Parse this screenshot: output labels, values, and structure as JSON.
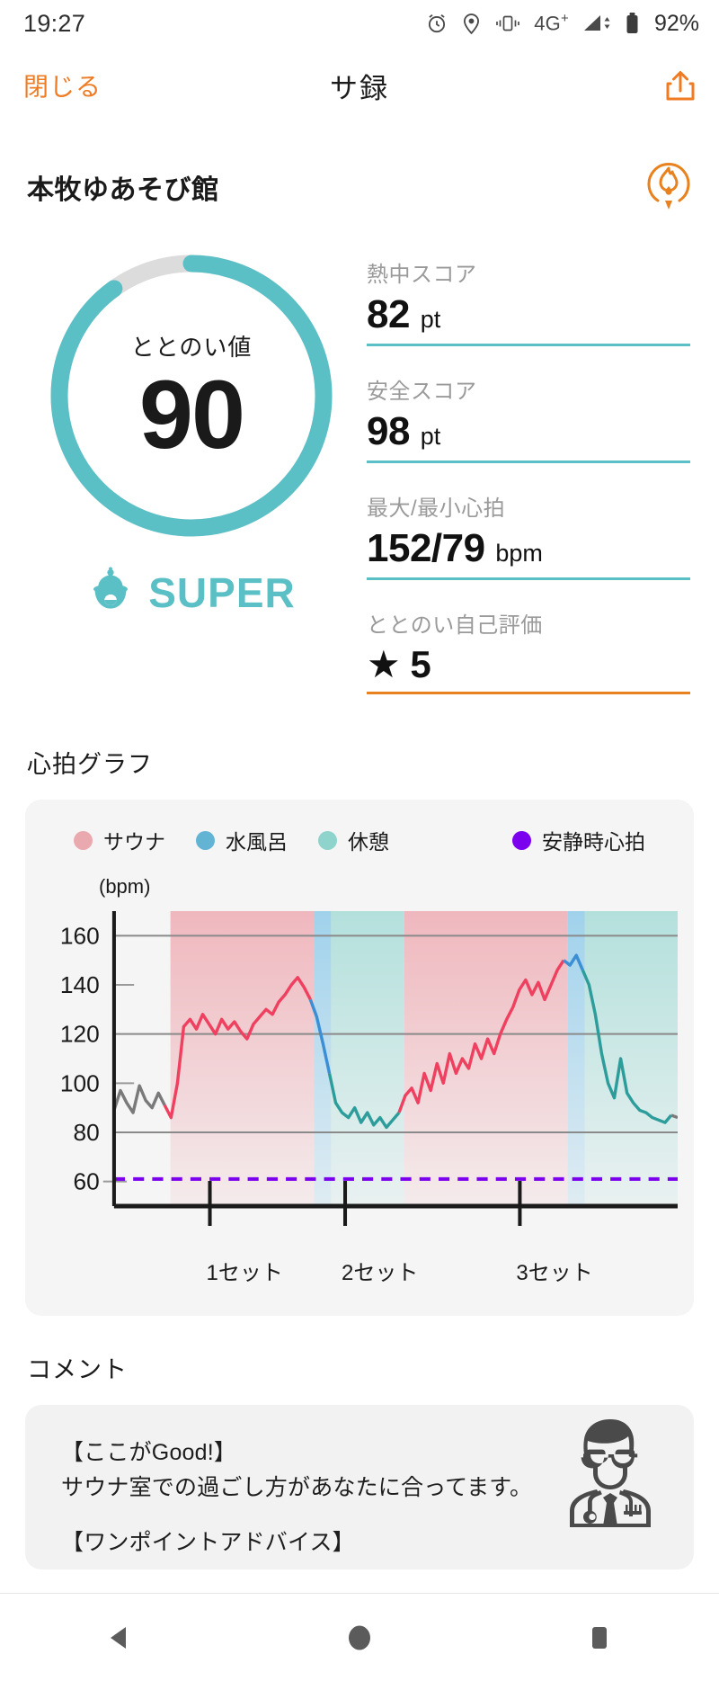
{
  "status_bar": {
    "time": "19:27",
    "network": "4G",
    "network_sup": "+",
    "battery": "92%",
    "icons": [
      "alarm-icon",
      "location-icon",
      "vibrate-icon",
      "signal-icon",
      "battery-icon"
    ]
  },
  "nav": {
    "close_label": "閉じる",
    "title": "サ録",
    "share_icon": "share-icon",
    "close_color": "#ef7b22"
  },
  "venue": {
    "name": "本牧ゆあそび館",
    "badge_icon": "flame-circle-icon",
    "badge_color": "#e8821e"
  },
  "gauge": {
    "label": "ととのい値",
    "value": "90",
    "percent": 90,
    "track_color": "#dcdcdc",
    "fill_color": "#5bc0c6",
    "rank_label": "SUPER",
    "rank_icon": "sauna-hat-character-icon",
    "rank_color": "#5bc0c6"
  },
  "stats": [
    {
      "label": "熱中スコア",
      "value": "82",
      "unit": "pt",
      "rule_color": "#5bc0c6"
    },
    {
      "label": "安全スコア",
      "value": "98",
      "unit": "pt",
      "rule_color": "#5bc0c6"
    },
    {
      "label": "最大/最小心拍",
      "value": "152/79",
      "unit": "bpm",
      "rule_color": "#5bc0c6"
    },
    {
      "label": "ととのい自己評価",
      "value": "★ 5",
      "unit": "",
      "rule_color": "#e8821e"
    }
  ],
  "chart_section": {
    "title": "心拍グラフ"
  },
  "chart_data": {
    "type": "line",
    "title": "心拍グラフ",
    "xlabel": "",
    "ylabel": "(bpm)",
    "ylim": [
      50,
      170
    ],
    "yticks": [
      60,
      80,
      100,
      120,
      140,
      160
    ],
    "gridlines": [
      80,
      120,
      160
    ],
    "grid": true,
    "legend_position": "top",
    "legend": [
      {
        "name": "サウナ",
        "color": "#eaa9ae"
      },
      {
        "name": "水風呂",
        "color": "#63b3d4"
      },
      {
        "name": "休憩",
        "color": "#8ed3cc"
      },
      {
        "name": "安静時心拍",
        "color": "#7b00ee"
      }
    ],
    "xticks": [
      "1セット",
      "2セット",
      "3セット"
    ],
    "xtick_positions": [
      0.17,
      0.41,
      0.72
    ],
    "resting_hr": 61,
    "series": [
      {
        "name": "心拍",
        "color": "#ef4060",
        "values": [
          89,
          97,
          92,
          88,
          99,
          93,
          90,
          96,
          91,
          86,
          100,
          123,
          126,
          122,
          128,
          124,
          120,
          126,
          122,
          125,
          121,
          118,
          124,
          127,
          130,
          128,
          133,
          136,
          140,
          143,
          139,
          134,
          127,
          116,
          104,
          92,
          88,
          86,
          90,
          84,
          88,
          83,
          86,
          82,
          85,
          88,
          95,
          98,
          92,
          104,
          97,
          108,
          100,
          112,
          104,
          110,
          106,
          116,
          110,
          118,
          112,
          120,
          126,
          131,
          138,
          142,
          136,
          141,
          134,
          140,
          146,
          150,
          148,
          152,
          146,
          140,
          128,
          112,
          100,
          94,
          110,
          96,
          92,
          89,
          88,
          86,
          85,
          84,
          87,
          86
        ]
      }
    ],
    "phases": [
      {
        "type": "サウナ",
        "start": 0.1,
        "end": 0.355,
        "set": 1
      },
      {
        "type": "水風呂",
        "start": 0.355,
        "end": 0.385,
        "set": 1
      },
      {
        "type": "休憩",
        "start": 0.385,
        "end": 0.515,
        "set": 1
      },
      {
        "type": "サウナ",
        "start": 0.515,
        "end": 0.805,
        "set": 2
      },
      {
        "type": "水風呂",
        "start": 0.805,
        "end": 0.835,
        "set": 2
      },
      {
        "type": "休憩",
        "start": 0.835,
        "end": 1.0,
        "set": 3
      }
    ]
  },
  "comment_section": {
    "title": "コメント",
    "lines": [
      "【ここがGood!】",
      "サウナ室での過ごし方があなたに合ってます。",
      "",
      "【ワンポイントアドバイス】"
    ],
    "avatar_icon": "doctor-avatar-icon"
  },
  "android_nav": {
    "back": "back-triangle-icon",
    "home": "home-circle-icon",
    "recents": "recents-square-icon"
  }
}
